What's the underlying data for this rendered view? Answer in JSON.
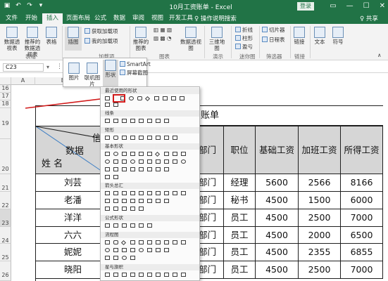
{
  "titlebar": {
    "title": "10月工资账单 - Excel",
    "login_label": "登录",
    "qat": {
      "save_icon": "save-icon",
      "undo_icon": "undo-icon",
      "redo_icon": "redo-icon"
    },
    "window_controls": [
      "▭",
      "—",
      "☐",
      "✕"
    ]
  },
  "tabs": [
    {
      "label": "文件"
    },
    {
      "label": "开始"
    },
    {
      "label": "插入"
    },
    {
      "label": "页面布局"
    },
    {
      "label": "公式"
    },
    {
      "label": "数据"
    },
    {
      "label": "审阅"
    },
    {
      "label": "视图"
    },
    {
      "label": "开发工具"
    }
  ],
  "active_tab": "插入",
  "tellme": "♀ 操作说明搜索",
  "share": "♀ 共享",
  "ribbon": {
    "table_group": {
      "label": "表格",
      "buttons": [
        "数据透视表",
        "推荐的数据透视表",
        "表格"
      ]
    },
    "illustrations": {
      "button": "插图",
      "label": "加载项"
    },
    "addins": [
      "获取加载项",
      "我的加载项"
    ],
    "charts": {
      "label": "图表",
      "buttons": [
        "推荐的图表",
        "数据透视图"
      ]
    },
    "tours": {
      "label": "演示",
      "buttons": [
        "三维地图"
      ]
    },
    "sparklines": {
      "label": "迷你图",
      "buttons": [
        "折线",
        "柱形",
        "盈亏"
      ]
    },
    "filters": {
      "label": "筛选器",
      "buttons": [
        "切片器",
        "日程表"
      ]
    },
    "links": {
      "label": "链接",
      "buttons": [
        "链接"
      ]
    },
    "text": {
      "label": "",
      "buttons": [
        "文本",
        "符号"
      ]
    }
  },
  "formula_bar": {
    "name_box": "C23"
  },
  "sheet": {
    "columns": [
      "A",
      "B",
      "C",
      "D",
      "E",
      "F",
      "G",
      "H",
      "I"
    ],
    "row_numbers": [
      "16",
      "17",
      "18",
      "19",
      "20",
      "21",
      "22",
      "23",
      "24",
      "25",
      "26",
      "27"
    ],
    "title_fragment": "资账单",
    "header_diag": {
      "top": "信",
      "mid": "数据",
      "bottom": "姓 名"
    },
    "headers": [
      "部门",
      "职位",
      "基础工资",
      "加班工资",
      "所得工资"
    ],
    "rows": [
      {
        "name": "刘芸",
        "dept": "部门",
        "pos": "经理",
        "base": "5600",
        "ot": "2566",
        "total": "8166"
      },
      {
        "name": "老潘",
        "dept": "部门",
        "pos": "秘书",
        "base": "4500",
        "ot": "1500",
        "total": "6000"
      },
      {
        "name": "洋洋",
        "dept": "部门",
        "pos": "员工",
        "base": "4500",
        "ot": "2500",
        "total": "7000"
      },
      {
        "name": "六六",
        "dept": "部门",
        "pos": "员工",
        "base": "4500",
        "ot": "2000",
        "total": "6500"
      },
      {
        "name": "妮妮",
        "dept": "部门",
        "pos": "员工",
        "base": "4500",
        "ot": "2355",
        "total": "6855"
      },
      {
        "name": "晓阳",
        "dept": "部门",
        "pos": "员工",
        "base": "4500",
        "ot": "2500",
        "total": "7000"
      }
    ]
  },
  "illustrations_popup": {
    "items": [
      "图片",
      "联机图片",
      "形状"
    ],
    "smartart": "SmartArt",
    "screenshot": "屏幕截图"
  },
  "shapes_popup": {
    "sections": [
      "最近使用的形状",
      "线条",
      "矩形",
      "基本形状",
      "箭头总汇",
      "公式形状",
      "流程图",
      "星与旗帜"
    ]
  },
  "colors": {
    "excel_green": "#217346",
    "highlight_red": "#d21b1b"
  }
}
